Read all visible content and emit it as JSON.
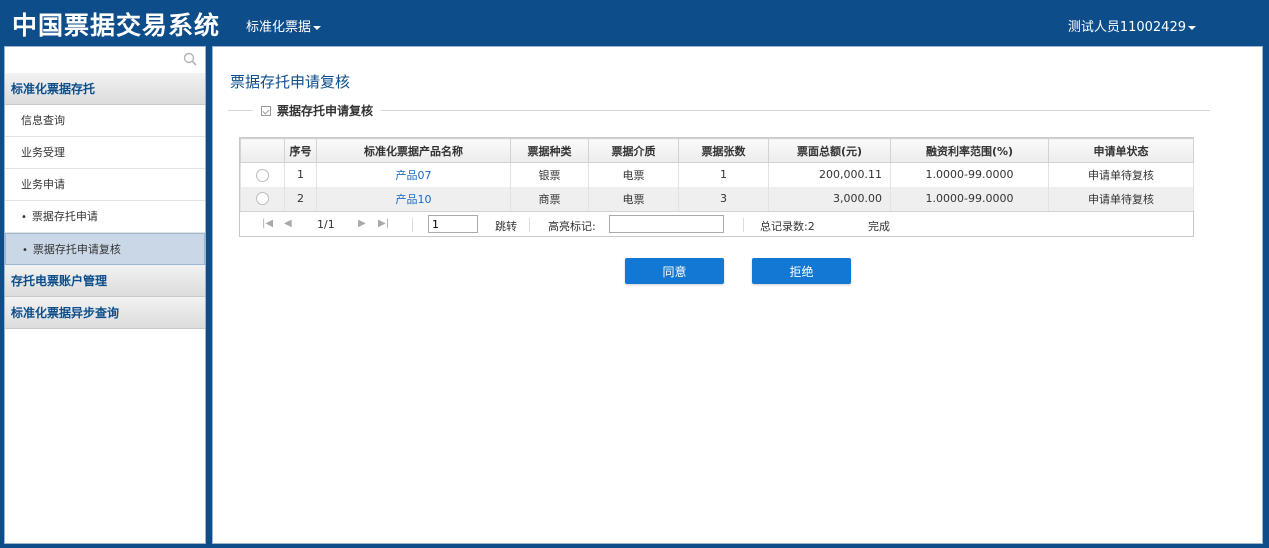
{
  "header": {
    "app_title": "中国票据交易系统",
    "module_menu": "标准化票据",
    "user_menu": "测试人员11002429"
  },
  "sidebar": {
    "search_placeholder": "",
    "groups": [
      {
        "label": "标准化票据存托",
        "items": [
          {
            "label": "信息查询"
          },
          {
            "label": "业务受理"
          },
          {
            "label": "业务申请"
          }
        ],
        "subitems": [
          {
            "label": "票据存托申请",
            "active": false
          },
          {
            "label": "票据存托申请复核",
            "active": true
          }
        ]
      },
      {
        "label": "存托电票账户管理"
      },
      {
        "label": "标准化票据异步查询"
      }
    ]
  },
  "main": {
    "page_title": "票据存托申请复核",
    "section_title": "票据存托申请复核",
    "table": {
      "columns": [
        "",
        "序号",
        "标准化票据产品名称",
        "票据种类",
        "票据介质",
        "票据张数",
        "票面总额(元)",
        "融资利率范围(%)",
        "申请单状态"
      ],
      "rows": [
        {
          "seq": "1",
          "product": "产品07",
          "type": "银票",
          "medium": "电票",
          "count": "1",
          "amount": "200,000.11",
          "rate": "1.0000-99.0000",
          "status": "申请单待复核"
        },
        {
          "seq": "2",
          "product": "产品10",
          "type": "商票",
          "medium": "电票",
          "count": "3",
          "amount": "3,000.00",
          "rate": "1.0000-99.0000",
          "status": "申请单待复核"
        }
      ]
    },
    "pager": {
      "page_info": "1/1",
      "page_input": "1",
      "goto_label": "跳转",
      "highlight_label": "高亮标记:",
      "total_label": "总记录数:2",
      "done_label": "完成"
    },
    "buttons": {
      "agree": "同意",
      "reject": "拒绝"
    }
  },
  "colors": {
    "brand": "#0d4d8a",
    "button": "#1378d4",
    "link": "#1a6bbf"
  }
}
